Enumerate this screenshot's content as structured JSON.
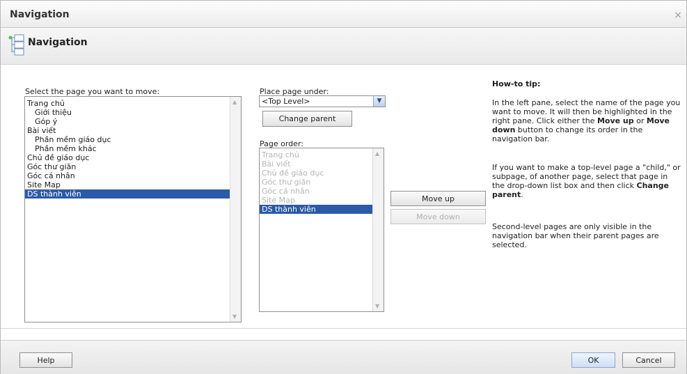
{
  "window": {
    "title": "Navigation",
    "close_glyph": "×"
  },
  "header": {
    "title": "Navigation",
    "icon": "navigation-pages-icon"
  },
  "left": {
    "label": "Select the page you want to move:",
    "items": [
      {
        "text": "Trang chủ",
        "indent": false
      },
      {
        "text": "Giới thiệu",
        "indent": true
      },
      {
        "text": "Góp ý",
        "indent": true
      },
      {
        "text": "Bài viết",
        "indent": false
      },
      {
        "text": "Phần mềm giáo dục",
        "indent": true
      },
      {
        "text": "Phần mềm khác",
        "indent": true
      },
      {
        "text": "Chủ đề giáo dục",
        "indent": false
      },
      {
        "text": "Góc thư giãn",
        "indent": false
      },
      {
        "text": "Góc cá nhân",
        "indent": false
      },
      {
        "text": "Site Map",
        "indent": false
      },
      {
        "text": "DS thành viên",
        "indent": false,
        "selected": true
      }
    ]
  },
  "middle": {
    "place_label": "Place page under:",
    "place_value": "<Top Level>",
    "change_parent": "Change parent",
    "order_label": "Page order:",
    "order_items": [
      {
        "text": "Trang chủ"
      },
      {
        "text": "Bài viết"
      },
      {
        "text": "Chủ đề giáo dục"
      },
      {
        "text": "Góc thư giãn"
      },
      {
        "text": "Góc cá nhân"
      },
      {
        "text": "Site Map"
      },
      {
        "text": "DS thành viên",
        "selected": true
      }
    ],
    "move_up": "Move up",
    "move_down": "Move down"
  },
  "tip": {
    "heading": "How-to tip:",
    "p1_a": "In the left pane, select the name of the page you want to move. It will then be highlighted in the right pane. Click either the ",
    "p1_b": "Move up",
    "p1_c": " or ",
    "p1_d": "Move down",
    "p1_e": " button to change its order in the navigation bar.",
    "p2_a": "If you want to make a top-level page a \"child,\" or subpage, of another page, select that page in the drop-down list box and then click ",
    "p2_b": "Change parent",
    "p2_c": ".",
    "p3": "Second-level pages are only visible in the navigation bar when their parent pages are selected."
  },
  "footer": {
    "help": "Help",
    "ok": "OK",
    "cancel": "Cancel"
  },
  "colors": {
    "selection": "#2b5aa8",
    "accent": "#8aa6d6"
  }
}
